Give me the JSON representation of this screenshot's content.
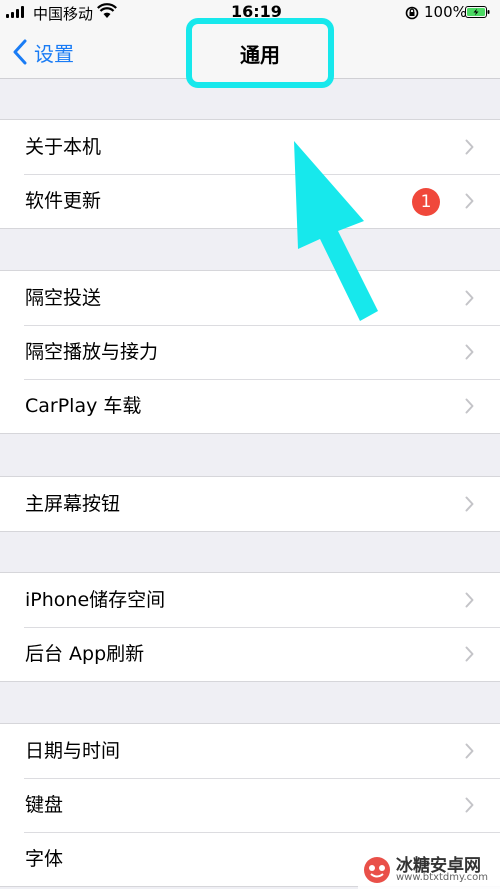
{
  "status_bar": {
    "carrier": "中国移动",
    "time": "16:19",
    "battery": "100%"
  },
  "nav": {
    "back_label": "设置",
    "title": "通用"
  },
  "groups": [
    [
      {
        "label": "关于本机"
      },
      {
        "label": "软件更新",
        "badge": "1"
      }
    ],
    [
      {
        "label": "隔空投送"
      },
      {
        "label": "隔空播放与接力"
      },
      {
        "label": "CarPlay 车载"
      }
    ],
    [
      {
        "label": "主屏幕按钮"
      }
    ],
    [
      {
        "label": "iPhone储存空间"
      },
      {
        "label": "后台 App刷新"
      }
    ],
    [
      {
        "label": "日期与时间"
      },
      {
        "label": "键盘"
      },
      {
        "label": "字体"
      }
    ]
  ],
  "watermark": {
    "name": "冰糖安卓网",
    "url": "www.btxtdmy.com"
  },
  "colors": {
    "accent": "#1a7cf5",
    "highlight": "#17e8ec",
    "badge": "#f0483b"
  }
}
